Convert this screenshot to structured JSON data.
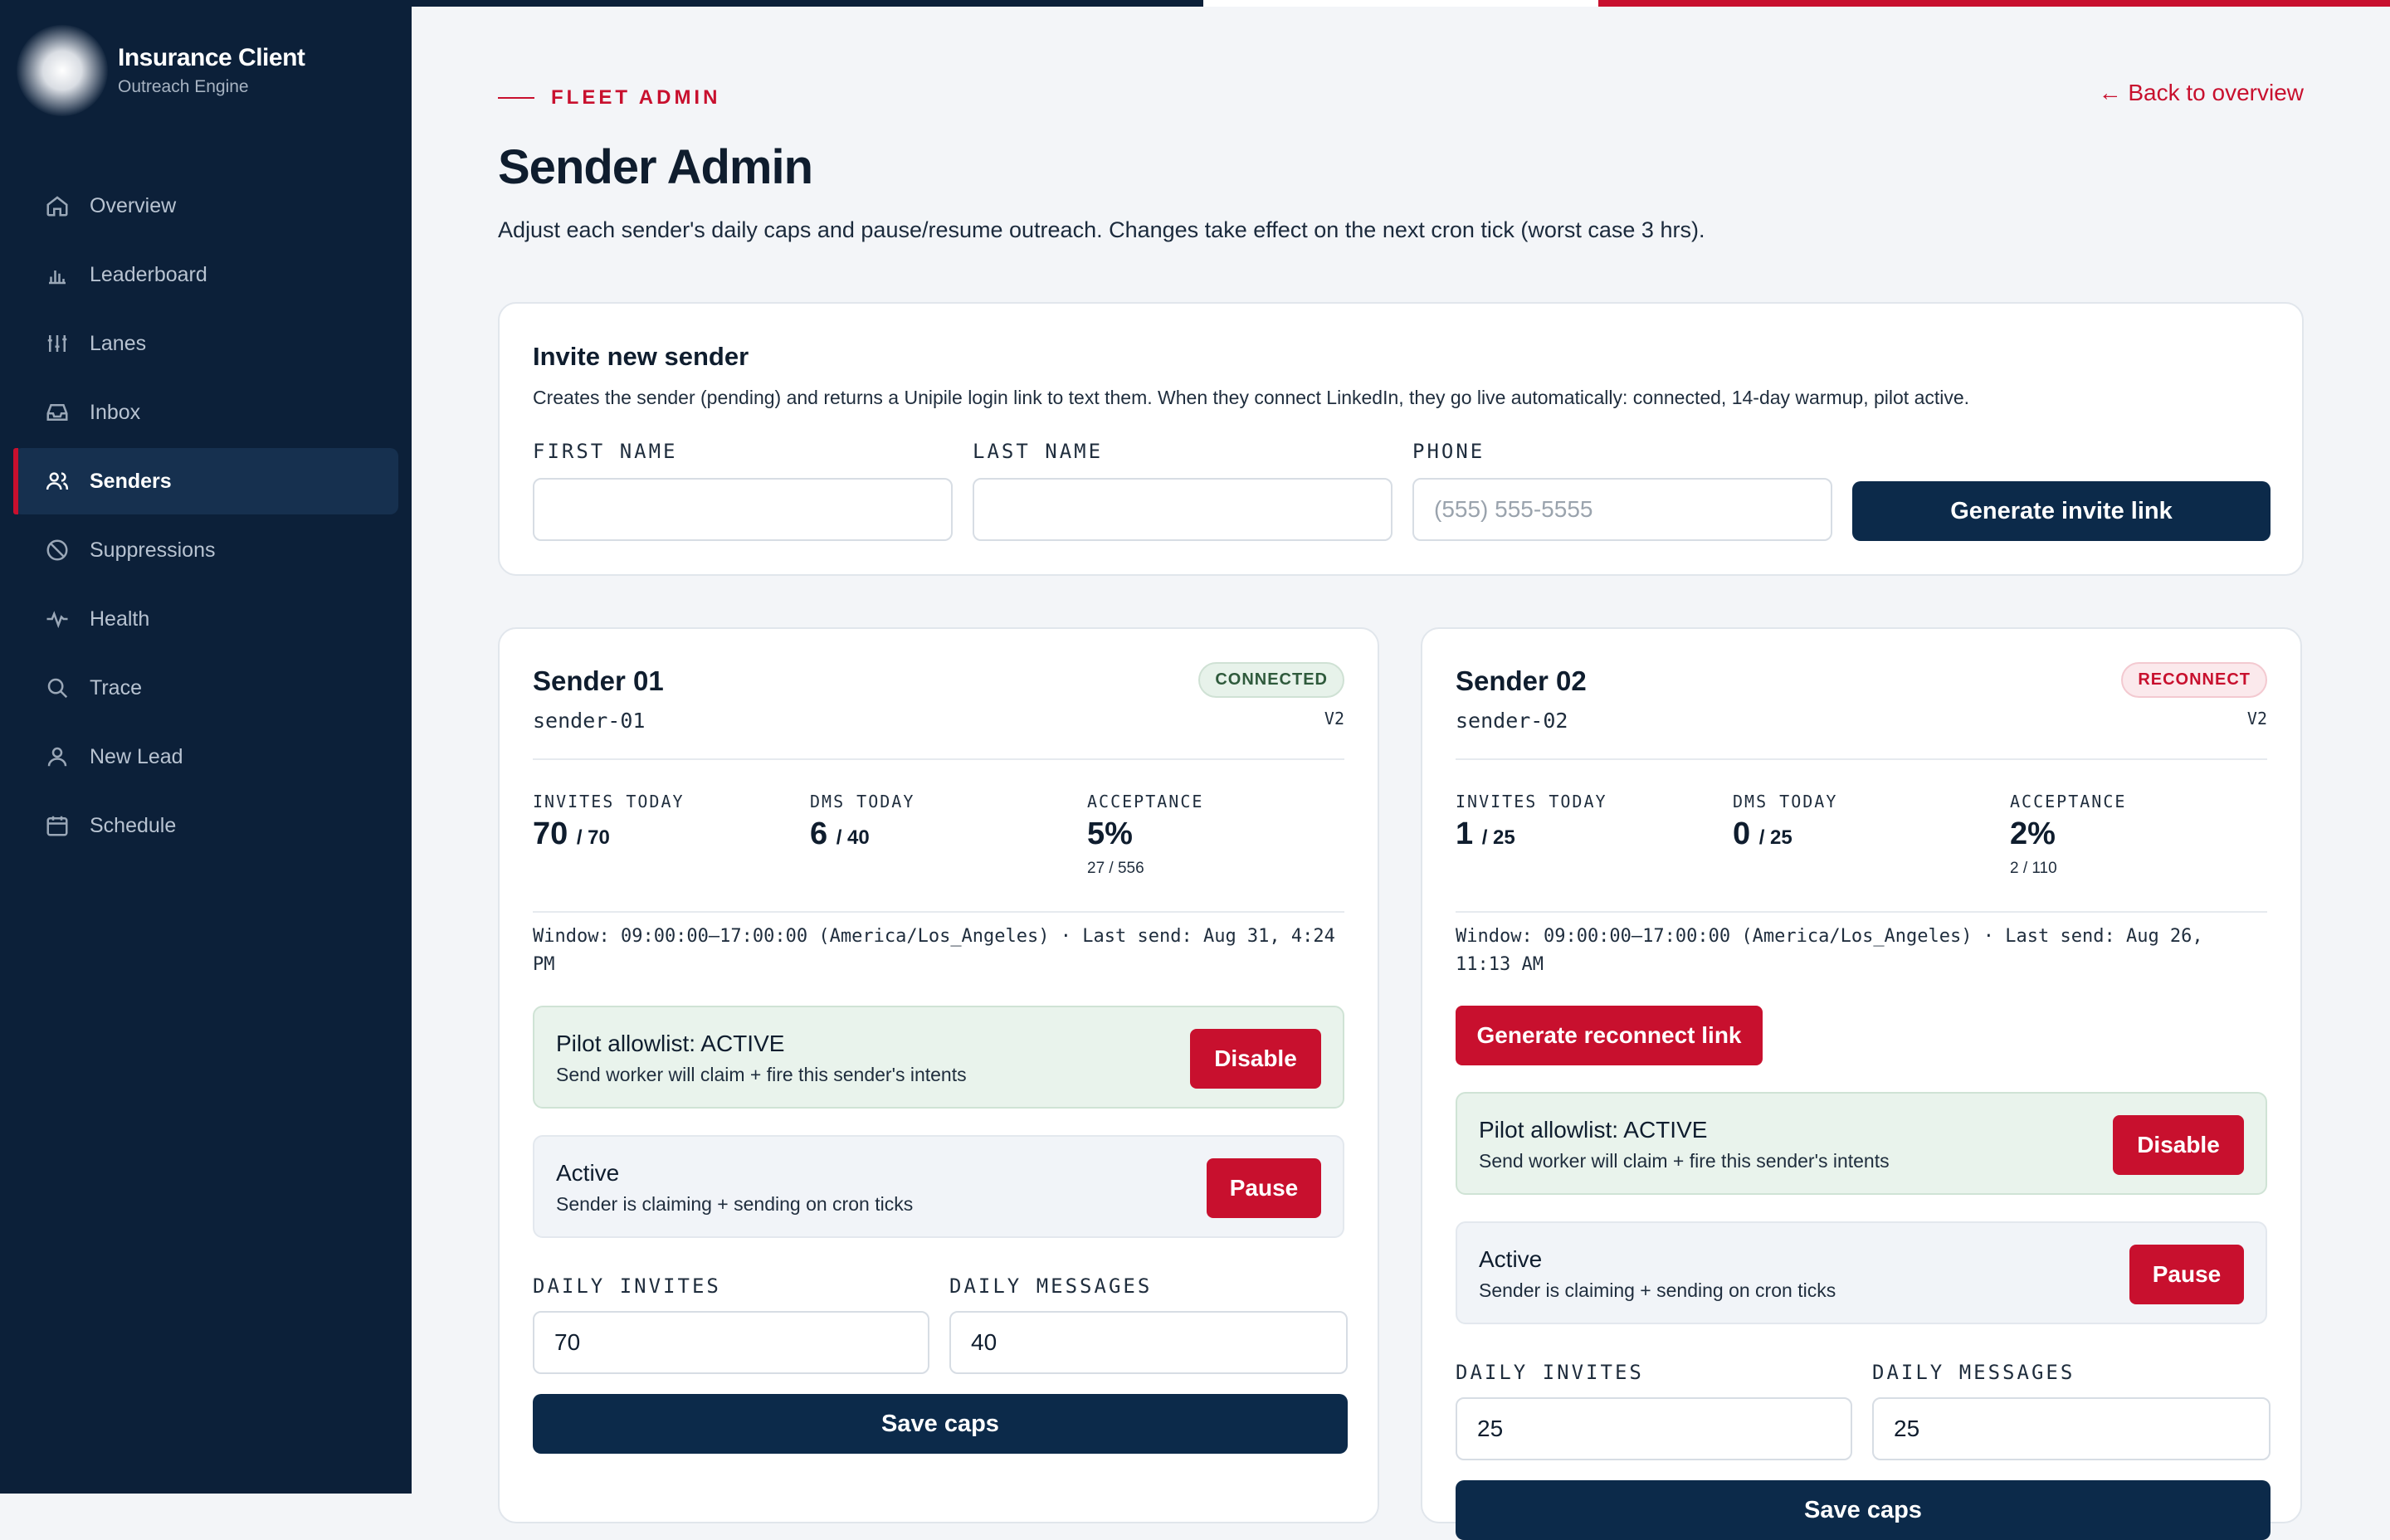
{
  "brand": {
    "title": "Insurance Client",
    "subtitle": "Outreach Engine"
  },
  "nav": [
    {
      "label": "Overview",
      "icon": "home-icon"
    },
    {
      "label": "Leaderboard",
      "icon": "bar-chart-icon"
    },
    {
      "label": "Lanes",
      "icon": "sliders-icon"
    },
    {
      "label": "Inbox",
      "icon": "inbox-icon"
    },
    {
      "label": "Senders",
      "icon": "users-icon",
      "active": true
    },
    {
      "label": "Suppressions",
      "icon": "ban-icon"
    },
    {
      "label": "Health",
      "icon": "pulse-icon"
    },
    {
      "label": "Trace",
      "icon": "search-icon"
    },
    {
      "label": "New Lead",
      "icon": "user-icon"
    },
    {
      "label": "Schedule",
      "icon": "calendar-icon"
    }
  ],
  "header": {
    "eyebrow": "FLEET ADMIN",
    "back_link": "← Back to overview",
    "title": "Sender Admin",
    "description": "Adjust each sender's daily caps and pause/resume outreach. Changes take effect on the next cron tick (worst case 3 hrs)."
  },
  "invite": {
    "title": "Invite new sender",
    "description": "Creates the sender (pending) and returns a Unipile login link to text them. When they connect LinkedIn, they go live automatically: connected, 14-day warmup, pilot active.",
    "first_name_label": "FIRST NAME",
    "first_name_value": "",
    "last_name_label": "LAST NAME",
    "last_name_value": "",
    "phone_label": "PHONE",
    "phone_value": "",
    "phone_placeholder": "(555) 555-5555",
    "button": "Generate invite link"
  },
  "senders": [
    {
      "name": "Sender 01",
      "id": "sender-01",
      "status": "CONNECTED",
      "version": "V2",
      "invites_label": "INVITES TODAY",
      "invites_today": "70",
      "invites_cap": "/ 70",
      "dms_label": "DMS TODAY",
      "dms_today": "6",
      "dms_cap": "/ 40",
      "acceptance_label": "ACCEPTANCE",
      "acceptance": "5%",
      "acceptance_fraction": "27 / 556",
      "window": "Window: 09:00:00–17:00:00 (America/Los_Angeles) · Last send: Aug 31, 4:24 PM",
      "pilot_title": "Pilot allowlist: ACTIVE",
      "pilot_sub": "Send worker will claim + fire this sender's intents",
      "pilot_button": "Disable",
      "active_title": "Active",
      "active_sub": "Sender is claiming + sending on cron ticks",
      "active_button": "Pause",
      "daily_invites_label": "DAILY INVITES",
      "daily_invites": "70",
      "daily_messages_label": "DAILY MESSAGES",
      "daily_messages": "40",
      "save_button": "Save caps"
    },
    {
      "name": "Sender 02",
      "id": "sender-02",
      "status": "RECONNECT",
      "version": "V2",
      "invites_label": "INVITES TODAY",
      "invites_today": "1",
      "invites_cap": "/ 25",
      "dms_label": "DMS TODAY",
      "dms_today": "0",
      "dms_cap": "/ 25",
      "acceptance_label": "ACCEPTANCE",
      "acceptance": "2%",
      "acceptance_fraction": "2 / 110",
      "window": "Window: 09:00:00–17:00:00 (America/Los_Angeles) · Last send: Aug 26, 11:13 AM",
      "reconnect_button": "Generate reconnect link",
      "pilot_title": "Pilot allowlist: ACTIVE",
      "pilot_sub": "Send worker will claim + fire this sender's intents",
      "pilot_button": "Disable",
      "active_title": "Active",
      "active_sub": "Sender is claiming + sending on cron ticks",
      "active_button": "Pause",
      "daily_invites_label": "DAILY INVITES",
      "daily_invites": "25",
      "daily_messages_label": "DAILY MESSAGES",
      "daily_messages": "25",
      "save_button": "Save caps"
    }
  ]
}
